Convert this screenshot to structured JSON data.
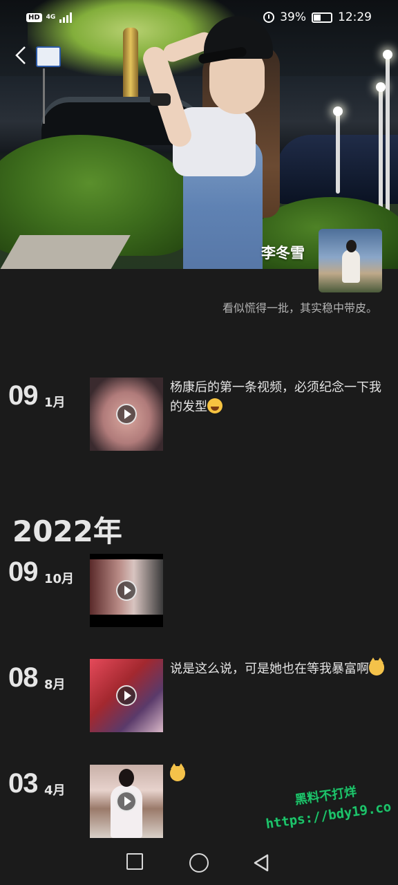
{
  "status_bar": {
    "network_badge": "HD",
    "network_type": "4G",
    "battery_percent": "39%",
    "time": "12:29",
    "battery_level": 0.39
  },
  "profile": {
    "name": "李冬雪",
    "signature": "看似慌得一批，其实稳中带皮。"
  },
  "timeline": {
    "first": {
      "day": "09",
      "month": "1月",
      "caption": "杨康后的第一条视频，必须纪念一下我的发型",
      "emoji": "laugh-emoji"
    },
    "year_heading": "2022年",
    "entries": [
      {
        "day": "09",
        "month": "10月",
        "caption": ""
      },
      {
        "day": "08",
        "month": "8月",
        "caption": "说是这么说，可是她也在等我暴富啊",
        "emoji": "cat-emoji"
      },
      {
        "day": "03",
        "month": "4月",
        "caption": "",
        "emoji": "cat-emoji"
      }
    ]
  },
  "watermark": {
    "line1": "黑料不打烊",
    "line2": "https://bdy19.co"
  },
  "nav_bar": {
    "recent_icon": "square-icon",
    "home_icon": "circle-icon",
    "back_icon": "triangle-back-icon"
  }
}
